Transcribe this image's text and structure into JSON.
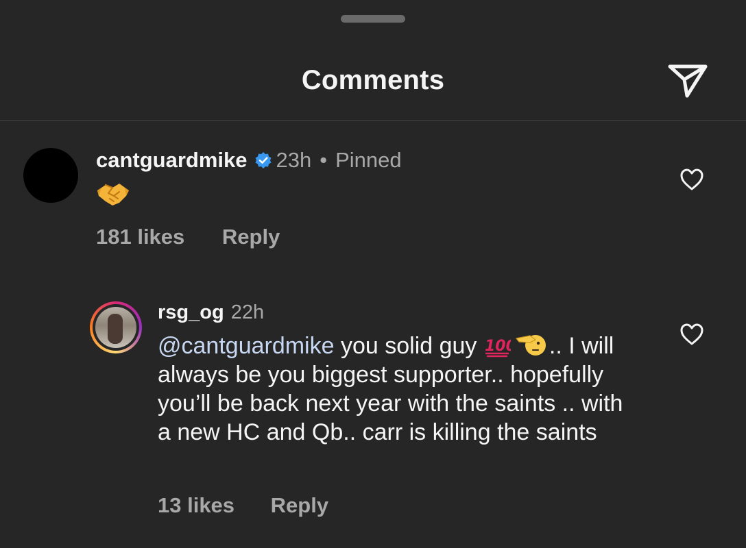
{
  "header": {
    "title": "Comments"
  },
  "comments": [
    {
      "username": "cantguardmike",
      "verified": true,
      "time": "23h",
      "separator": "•",
      "status": "Pinned",
      "body_emoji": "handshake",
      "likes": "181 likes",
      "reply_label": "Reply"
    }
  ],
  "replies": [
    {
      "username": "rsg_og",
      "time": "22h",
      "mention": "@cantguardmike",
      "text_a": " you solid guy ",
      "text_b": ".. I will always be you biggest supporter.. hopefully you’ll be back next year with the saints .. with a new HC and Qb.. carr is killing the saints",
      "emojis": [
        "hundred-points",
        "saluting-face"
      ],
      "likes": "13 likes",
      "reply_label": "Reply"
    }
  ],
  "icons": {
    "share": "paper-plane-icon",
    "like": "heart-icon",
    "verified": "verified-badge-icon"
  },
  "colors": {
    "background": "#262626",
    "text": "#f5f5f5",
    "muted": "#a8a8a8",
    "verified": "#3897f0",
    "mention": "#c7d7f2"
  }
}
